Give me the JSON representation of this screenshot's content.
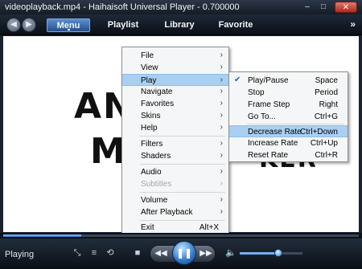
{
  "window": {
    "title": "videoplayback.mp4 - Haihaisoft Universal Player - 0.700000"
  },
  "menubar": {
    "tabs": [
      {
        "label": "Menu",
        "active": true
      },
      {
        "label": "Playlist"
      },
      {
        "label": "Library"
      },
      {
        "label": "Favorite"
      }
    ]
  },
  "video": {
    "line1": "ANN",
    "line2": "MO",
    "line3": "KER"
  },
  "main_menu": {
    "items": [
      {
        "label": "File",
        "submenu": true
      },
      {
        "label": "View",
        "submenu": true
      },
      {
        "label": "Play",
        "submenu": true,
        "highlighted": true
      },
      {
        "label": "Navigate",
        "submenu": true
      },
      {
        "label": "Favorites",
        "submenu": true
      },
      {
        "label": "Skins",
        "submenu": true
      },
      {
        "label": "Help",
        "submenu": true
      },
      {
        "label": "Filters",
        "submenu": true
      },
      {
        "label": "Shaders",
        "submenu": true
      },
      {
        "label": "Audio",
        "submenu": true
      },
      {
        "label": "Subtitles",
        "submenu": true,
        "disabled": true
      },
      {
        "label": "Volume",
        "submenu": true
      },
      {
        "label": "After Playback",
        "submenu": true
      },
      {
        "label": "Exit",
        "shortcut": "Alt+X"
      }
    ]
  },
  "play_menu": {
    "items": [
      {
        "label": "Play/Pause",
        "shortcut": "Space",
        "checked": true
      },
      {
        "label": "Stop",
        "shortcut": "Period"
      },
      {
        "label": "Frame Step",
        "shortcut": "Right"
      },
      {
        "label": "Go To...",
        "shortcut": "Ctrl+G"
      },
      {
        "label": "Decrease Rate",
        "shortcut": "Ctrl+Down",
        "highlighted": true
      },
      {
        "label": "Increase Rate",
        "shortcut": "Ctrl+Up"
      },
      {
        "label": "Reset Rate",
        "shortcut": "Ctrl+R"
      }
    ]
  },
  "controls": {
    "status": "Playing",
    "seek_progress": 0.22,
    "volume_level": 0.62
  },
  "icons": {
    "check": "✔",
    "submenu_arrow": "›"
  }
}
